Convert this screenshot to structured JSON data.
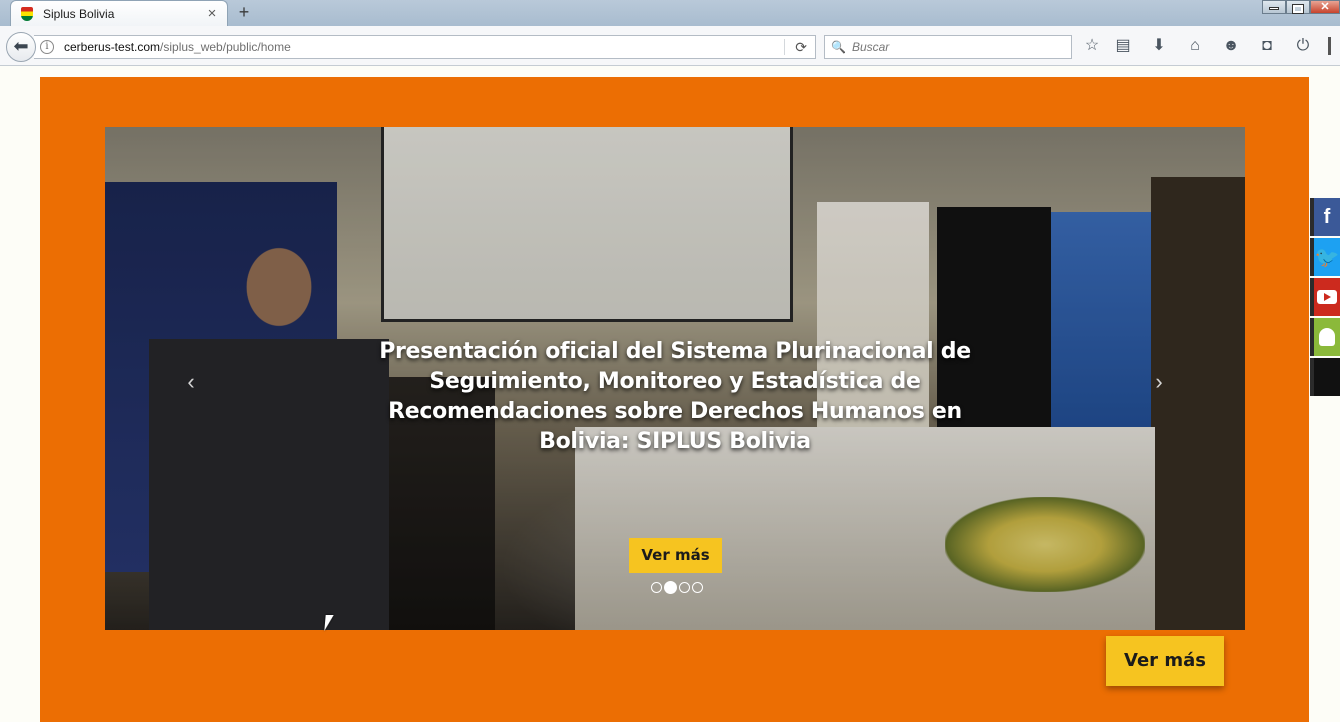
{
  "browser": {
    "tab_title": "Siplus Bolivia",
    "tab_close": "×",
    "new_tab": "+",
    "url_host": "cerberus-test.com",
    "url_path": "/siplus_web/public/home",
    "search_placeholder": "Buscar",
    "icons": [
      "back-arrow-icon",
      "info-icon",
      "reload-icon",
      "search-icon",
      "bookmark-star-icon",
      "reading-list-icon",
      "download-icon",
      "home-icon",
      "chat-icon",
      "pocket-icon",
      "power-icon",
      "menu-icon"
    ]
  },
  "carousel": {
    "caption": "Presentación oficial del Sistema Plurinacional de Seguimiento, Monitoreo y Estadística de Recomendaciones sobre Derechos Humanos en Bolivia: SIPLUS Bolivia",
    "button_label": "Ver más",
    "prev": "‹",
    "next": "›",
    "slide_count": 4,
    "active_slide": 2
  },
  "main": {
    "button_label": "Ver más"
  },
  "social": [
    {
      "name": "facebook",
      "glyph": "f",
      "color": "#3b5998"
    },
    {
      "name": "twitter",
      "glyph": "t",
      "color": "#1da1f2"
    },
    {
      "name": "youtube",
      "glyph": "",
      "color": "#cc2a1e"
    },
    {
      "name": "android",
      "glyph": "",
      "color": "#8bb93a"
    },
    {
      "name": "apple",
      "glyph": "",
      "color": "#111111"
    }
  ],
  "colors": {
    "panel": "#ec6e03",
    "button": "#f6c420",
    "page_bg": "#fdfdf7"
  }
}
